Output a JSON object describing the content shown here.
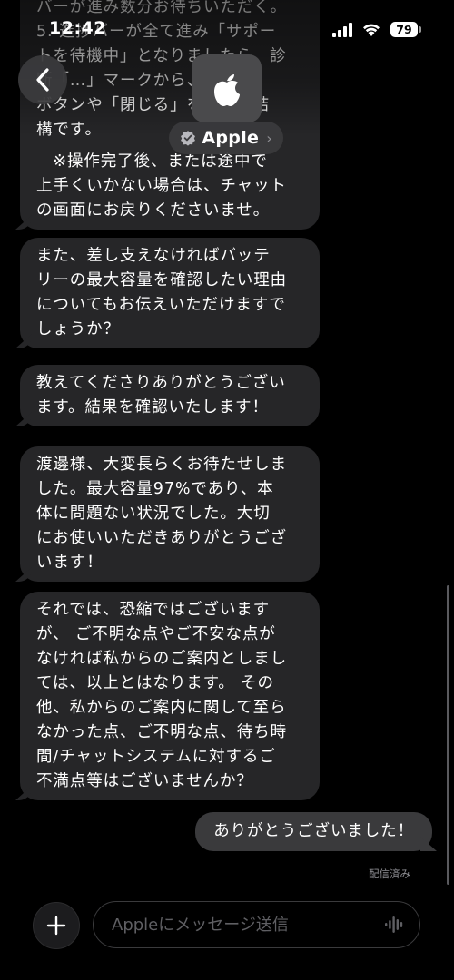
{
  "status_bar": {
    "time": "12:42",
    "battery": "79"
  },
  "header": {
    "contact_name": "Apple",
    "verified_icon": "checkmark-badge-icon",
    "avatar_icon": "apple-logo-icon"
  },
  "messages": [
    {
      "direction": "received",
      "lines": [
        "バーが進み数分お待ちいただく。",
        "5. 進捗バーが全て進み「サポー",
        "トを待機中」となりましたら、診",
        "断「…」マークから、×",
        "ボタンや「閉じる」を押して結",
        "構です。",
        "",
        "　※操作完了後、または途中で",
        "上手くいかない場合は、チャット",
        "の画面にお戻りくださいませ。"
      ]
    },
    {
      "direction": "received",
      "lines": [
        "また、差し支えなければバッテ",
        "リーの最大容量を確認したい理由",
        "についてもお伝えいただけますで",
        "しょうか？"
      ]
    },
    {
      "direction": "received",
      "lines": [
        "教えてくださりありがとうござい",
        "ます。結果を確認いたします！"
      ]
    },
    {
      "direction": "received",
      "lines": [
        "渡邊様、大変長らくお待たせしま",
        "した。最大容量97%であり、本",
        "体に問題ない状況でした。大切",
        "にお使いいただきありがとうござ",
        "います！"
      ]
    },
    {
      "direction": "received",
      "lines": [
        "それでは、恐縮ではございます",
        "が、 ご不明な点やご不安な点が",
        "なければ私からのご案内としまし",
        "ては、以上とはなります。 その",
        "他、私からのご案内に関して至ら",
        "なかった点、ご不明な点、待ち時",
        "間/チャットシステムに対するご",
        "不満点等はございませんか？"
      ]
    },
    {
      "direction": "sent",
      "lines": [
        "ありがとうございました！"
      ]
    }
  ],
  "delivered_label": "配信済み",
  "input": {
    "placeholder": "Appleにメッセージ送信"
  }
}
